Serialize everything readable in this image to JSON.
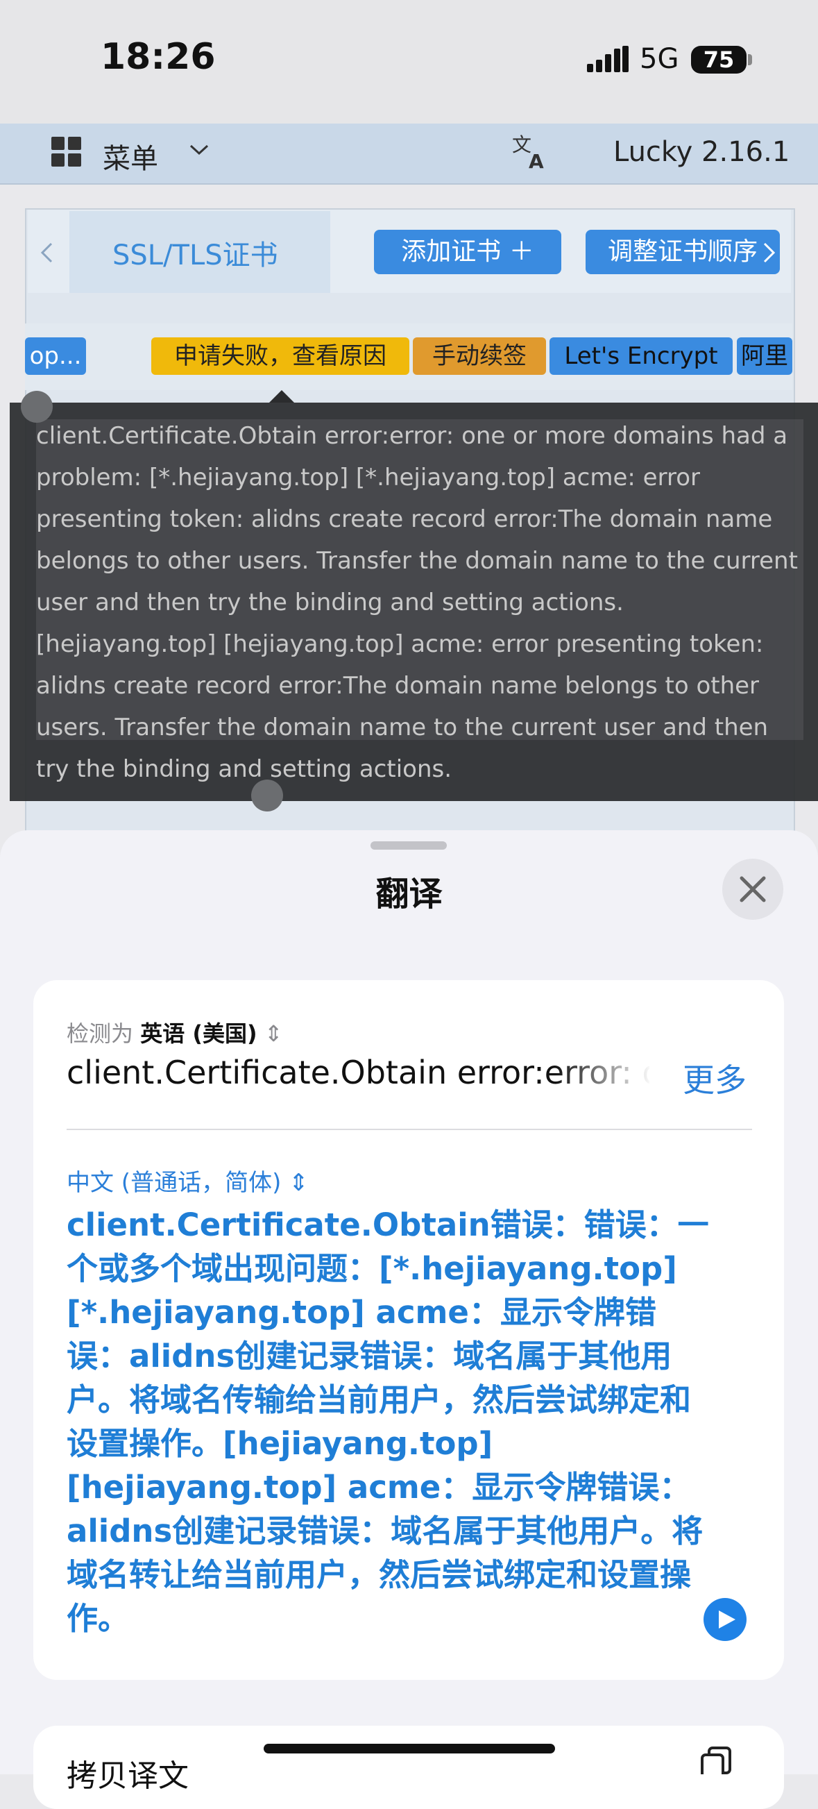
{
  "status_bar": {
    "time": "18:26",
    "network": "5G",
    "battery": "75"
  },
  "app": {
    "menu_label": "菜单",
    "version": "Lucky 2.16.1"
  },
  "tabs": {
    "active_label": "SSL/TLS证书",
    "add_cert": "添加证书 ＋",
    "reorder": "调整证书顺序"
  },
  "chips": {
    "domain_chip": "op...",
    "failed": "申请失败，查看原因",
    "manual_renew": "手动续签",
    "ca": "Let's Encrypt",
    "provider": "阿里"
  },
  "tooltip": {
    "text": "client.Certificate.Obtain error:error: one or more domains had a problem: [*.hejiayang.top] [*.hejiayang.top] acme: error presenting token: alidns create record error:The domain name belongs to other users. Transfer the domain name to the current user and then try the binding and setting actions. [hejiayang.top] [hejiayang.top] acme: error presenting token: alidns create record error:The domain name belongs to other users. Transfer the domain name to the current user and then try the binding and setting actions."
  },
  "translate_sheet": {
    "title": "翻译",
    "detected_prefix": "检测为",
    "source_language": "英语 (美国)",
    "source_text": "client.Certificate.Obtain error:error: one",
    "more": "更多",
    "target_language": "中文 (普通话，简体)",
    "translated_text": "client.Certificate.Obtain错误：错误：一个或多个域出现问题：[*.hejiayang.top] [*.hejiayang.top] acme：显示令牌错误：alidns创建记录错误：域名属于其他用户。将域名传输给当前用户，然后尝试绑定和设置操作。[hejiayang.top] [hejiayang.top] acme：显示令牌错误：alidns创建记录错误：域名属于其他用户。将域名转让给当前用户，然后尝试绑定和设置操作。",
    "copy_translation": "拷贝译文"
  },
  "colors": {
    "accent": "#2b7fd9",
    "failed_chip": "#f0b90b",
    "renew_chip": "#e09a2e",
    "blue_chip": "#3a8be0"
  }
}
